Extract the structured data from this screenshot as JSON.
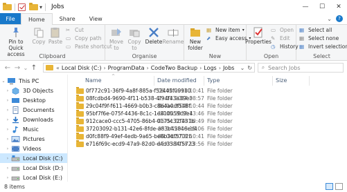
{
  "window": {
    "title": "Jobs",
    "qat_down": "▾",
    "controls": {
      "minimize": "—",
      "maximize": "☐",
      "close": "✕"
    }
  },
  "tabs": [
    {
      "label": "File"
    },
    {
      "label": "Home"
    },
    {
      "label": "Share"
    },
    {
      "label": "View"
    }
  ],
  "tabs_right": {
    "expand": "⌄",
    "help": "?"
  },
  "ribbon": {
    "clipboard": {
      "label": "Clipboard",
      "pin": "Pin to Quick access",
      "copy": "Copy",
      "paste": "Paste",
      "cut": "Cut",
      "copy_path": "Copy path",
      "paste_shortcut": "Paste shortcut"
    },
    "organise": {
      "label": "Organise",
      "move_to": "Move to",
      "copy_to": "Copy to",
      "delete": "Delete",
      "rename": "Rename"
    },
    "new": {
      "label": "New",
      "new_folder": "New folder",
      "new_item": "New item",
      "easy_access": "Easy access"
    },
    "open": {
      "label": "Open",
      "properties": "Properties",
      "open": "Open",
      "edit": "Edit",
      "history": "History"
    },
    "select": {
      "label": "Select",
      "select_all": "Select all",
      "select_none": "Select none",
      "invert_selection": "Invert selection"
    }
  },
  "address": {
    "back": "←",
    "forward": "→",
    "recent": "⌄",
    "up": "↑",
    "overflow": "«",
    "crumbs": [
      "Local Disk (C:)",
      "ProgramData",
      "CodeTwo Backup",
      "Logs",
      "Jobs"
    ],
    "sep": "›",
    "dropdown": "⌄",
    "refresh": "↻",
    "search_placeholder": "Search Jobs",
    "search_icon": "⌕"
  },
  "navpane": {
    "items": [
      {
        "label": "This PC",
        "icon": "pc-icon",
        "arrow": "⌄"
      },
      {
        "label": "3D Objects",
        "icon": "cube-icon",
        "arrow": "›"
      },
      {
        "label": "Desktop",
        "icon": "desktop-icon",
        "arrow": "›"
      },
      {
        "label": "Documents",
        "icon": "documents-icon",
        "arrow": "›"
      },
      {
        "label": "Downloads",
        "icon": "downloads-icon",
        "arrow": "›"
      },
      {
        "label": "Music",
        "icon": "music-icon",
        "arrow": "›"
      },
      {
        "label": "Pictures",
        "icon": "pictures-icon",
        "arrow": "›"
      },
      {
        "label": "Videos",
        "icon": "videos-icon",
        "arrow": "›"
      },
      {
        "label": "Local Disk (C:)",
        "icon": "drive-icon",
        "arrow": "›",
        "selected": true
      },
      {
        "label": "Local Disk (D:)",
        "icon": "drive-icon",
        "arrow": "›"
      },
      {
        "label": "Local Disk (E:)",
        "icon": "drive-icon",
        "arrow": "›"
      }
    ]
  },
  "list": {
    "sort_indicator": "^",
    "columns": [
      {
        "label": "Name"
      },
      {
        "label": "Date modified"
      },
      {
        "label": "Type"
      },
      {
        "label": "Size"
      }
    ],
    "rows": [
      {
        "name": "0f772c91-36f9-4a8f-885a-f52445f09910",
        "date": "06.04.2018 10:41",
        "type": "File folder"
      },
      {
        "name": "08fcdbd4-9690-4f11-b538-4f94f43a39e3",
        "date": "23.11.2017 08:57",
        "type": "File folder"
      },
      {
        "name": "29c04f9f-f611-4669-b0b3-c8b4a0df548f",
        "date": "06.04.2018 10:44",
        "type": "File folder"
      },
      {
        "name": "95bf7f6e-075f-4436-8c1c-1e810059c9e4",
        "date": "14.05.2018 13:46",
        "type": "File folder"
      },
      {
        "name": "912cace0-ccc5-4705-86b4-0175c32f431b",
        "date": "06.04.2018 10:49",
        "type": "File folder"
      },
      {
        "name": "37203092-b131-42e6-8fde-a83b45846ed4",
        "date": "05.04.2018 15:06",
        "type": "File folder"
      },
      {
        "name": "d0fc88f9-49ef-4edb-9a65-be8b3df5702b",
        "date": "06.04.2018 10:41",
        "type": "File folder"
      },
      {
        "name": "e716f69c-ecd9-47a9-82d0-e4d3384f5723",
        "date": "16.05.2018 13:56",
        "type": "File folder"
      }
    ]
  },
  "status": {
    "count": "8 items"
  },
  "colors": {
    "accent": "#1979ca",
    "folder": "#e8b537",
    "selected": "#cce8ff"
  }
}
